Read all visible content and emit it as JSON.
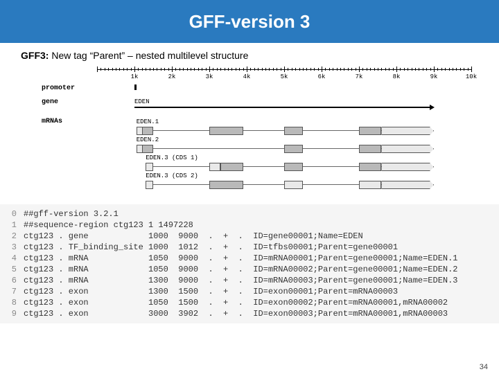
{
  "header": {
    "title": "GFF-version 3"
  },
  "subtitle": {
    "lead": "GFF3:",
    "rest": " New tag “Parent” – nested multilevel structure"
  },
  "diagram": {
    "ruler": {
      "start": 0,
      "end": 10000,
      "ticks": [
        {
          "pos": 1000,
          "label": "1k"
        },
        {
          "pos": 2000,
          "label": "2k"
        },
        {
          "pos": 3000,
          "label": "3k"
        },
        {
          "pos": 4000,
          "label": "4k"
        },
        {
          "pos": 5000,
          "label": "5k"
        },
        {
          "pos": 6000,
          "label": "6k"
        },
        {
          "pos": 7000,
          "label": "7k"
        },
        {
          "pos": 8000,
          "label": "8k"
        },
        {
          "pos": 9000,
          "label": "9k"
        },
        {
          "pos": 10000,
          "label": "10k"
        }
      ]
    },
    "rows": {
      "promoter_label": "promoter",
      "gene_label": "gene",
      "mrnas_label": "mRNAs"
    },
    "promoter": {
      "start": 1000,
      "end": 1012
    },
    "gene": {
      "name": "EDEN",
      "start": 1000,
      "end": 9000
    },
    "mrnas": [
      {
        "name": "EDEN.1",
        "start": 1050,
        "end": 9000,
        "segments": [
          {
            "start": 1050,
            "end": 1500,
            "cds": false
          },
          {
            "start": 1200,
            "end": 1500,
            "cds": true
          },
          {
            "start": 3000,
            "end": 3902,
            "cds": true
          },
          {
            "start": 5000,
            "end": 5500,
            "cds": true
          },
          {
            "start": 7000,
            "end": 7600,
            "cds": true
          },
          {
            "start": 7600,
            "end": 9000,
            "cds": false,
            "term": true
          }
        ]
      },
      {
        "name": "EDEN.2",
        "start": 1050,
        "end": 9000,
        "segments": [
          {
            "start": 1050,
            "end": 1500,
            "cds": false
          },
          {
            "start": 1200,
            "end": 1500,
            "cds": true
          },
          {
            "start": 5000,
            "end": 5500,
            "cds": true
          },
          {
            "start": 7000,
            "end": 7600,
            "cds": true
          },
          {
            "start": 7600,
            "end": 9000,
            "cds": false,
            "term": true
          }
        ]
      },
      {
        "name": "EDEN.3 (CDS 1)",
        "start": 1300,
        "end": 9000,
        "segments": [
          {
            "start": 1300,
            "end": 1500,
            "cds": false
          },
          {
            "start": 3000,
            "end": 3300,
            "cds": false
          },
          {
            "start": 3300,
            "end": 3902,
            "cds": true
          },
          {
            "start": 5000,
            "end": 5500,
            "cds": true
          },
          {
            "start": 7000,
            "end": 7600,
            "cds": true
          },
          {
            "start": 7600,
            "end": 9000,
            "cds": false,
            "term": true
          }
        ]
      },
      {
        "name": "EDEN.3 (CDS 2)",
        "start": 1300,
        "end": 9000,
        "segments": [
          {
            "start": 1300,
            "end": 1500,
            "cds": false
          },
          {
            "start": 3000,
            "end": 3902,
            "cds": true
          },
          {
            "start": 5000,
            "end": 5500,
            "cds": false
          },
          {
            "start": 7000,
            "end": 7600,
            "cds": false
          },
          {
            "start": 7600,
            "end": 9000,
            "cds": false,
            "term": true
          }
        ]
      }
    ]
  },
  "code": {
    "lines": [
      "##gff-version 3.2.1",
      "##sequence-region ctg123 1 1497228",
      "ctg123 . gene            1000  9000  .  +  .  ID=gene00001;Name=EDEN",
      "ctg123 . TF_binding_site 1000  1012  .  +  .  ID=tfbs00001;Parent=gene00001",
      "ctg123 . mRNA            1050  9000  .  +  .  ID=mRNA00001;Parent=gene00001;Name=EDEN.1",
      "ctg123 . mRNA            1050  9000  .  +  .  ID=mRNA00002;Parent=gene00001;Name=EDEN.2",
      "ctg123 . mRNA            1300  9000  .  +  .  ID=mRNA00003;Parent=gene00001;Name=EDEN.3",
      "ctg123 . exon            1300  1500  .  +  .  ID=exon00001;Parent=mRNA00003",
      "ctg123 . exon            1050  1500  .  +  .  ID=exon00002;Parent=mRNA00001,mRNA00002",
      "ctg123 . exon            3000  3902  .  +  .  ID=exon00003;Parent=mRNA00001,mRNA00003"
    ]
  },
  "page_number": "34"
}
